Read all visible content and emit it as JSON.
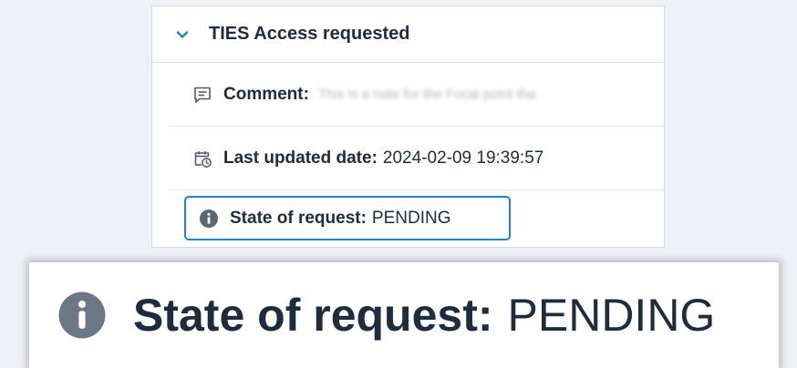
{
  "panel": {
    "title": "TIES Access requested",
    "expand_icon": "chevron-down-icon"
  },
  "rows": {
    "comment": {
      "icon": "comment-icon",
      "label": "Comment:",
      "value": "This is a note for the Focal point tha"
    },
    "last_updated": {
      "icon": "calendar-clock-icon",
      "label": "Last updated date:",
      "value": "2024-02-09 19:39:57"
    },
    "state": {
      "icon": "info-icon",
      "label": "State of request:",
      "value": "PENDING"
    }
  },
  "zoom": {
    "icon": "info-icon",
    "label": "State of request:",
    "value": "PENDING"
  },
  "colors": {
    "accent": "#1f83c7",
    "text": "#1d2d3e",
    "icon_grey": "#6b7785",
    "page_bg": "#eef2f7"
  }
}
